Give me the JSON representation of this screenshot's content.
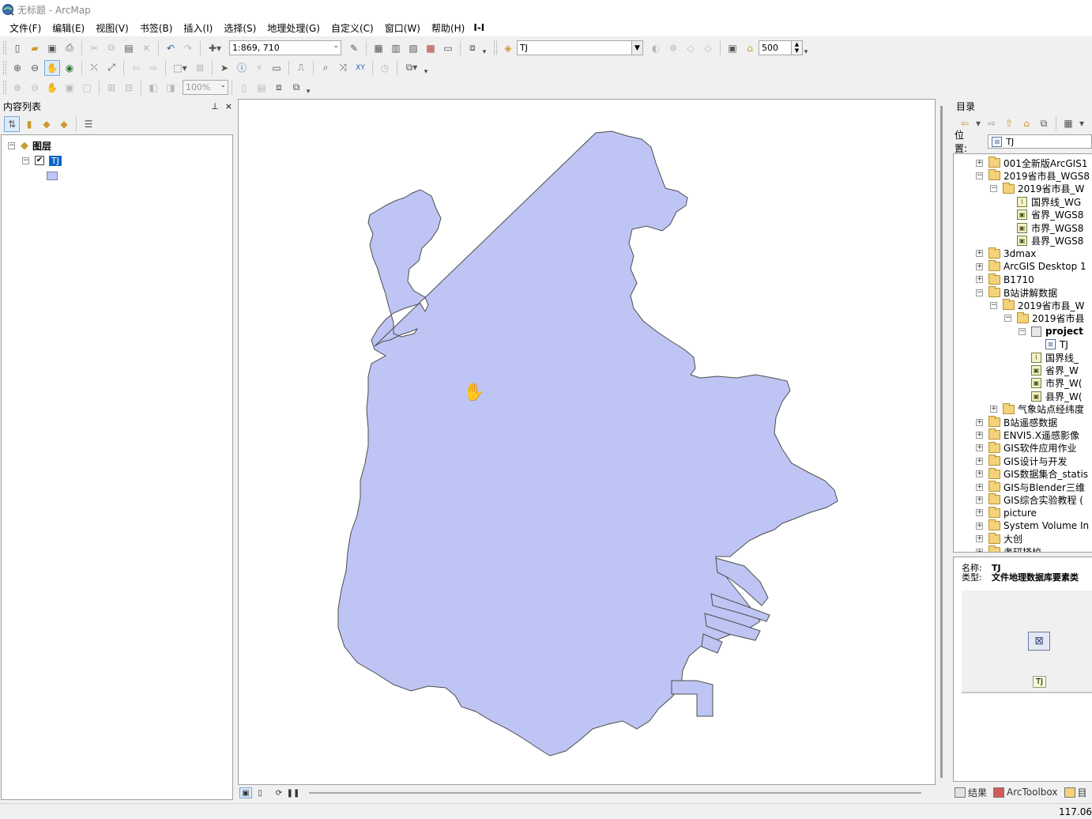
{
  "window": {
    "title": "无标题 - ArcMap"
  },
  "menu": {
    "items": [
      "文件(F)",
      "编辑(E)",
      "视图(V)",
      "书签(B)",
      "插入(I)",
      "选择(S)",
      "地理处理(G)",
      "自定义(C)",
      "窗口(W)",
      "帮助(H)"
    ],
    "grip": "I-I"
  },
  "standard_toolbar": {
    "scale_value": "1:869, 710",
    "target_layer": "TJ",
    "snap_tolerance": "500"
  },
  "layout_toolbar": {
    "zoom_percent": "100%"
  },
  "toc": {
    "title": "内容列表",
    "pin_label": "⊥",
    "close_label": "×",
    "root_label": "图层",
    "layer_name": "TJ",
    "layer_checked": "✔",
    "patch_color": "#bec5f4"
  },
  "map": {
    "fill_color": "#bec5f4",
    "outline_color": "#4d4d4d",
    "cursor": "✋"
  },
  "catalog": {
    "title": "目录",
    "location_label": "位置:",
    "location_value": "TJ",
    "tree": [
      {
        "label": "001全新版ArcGIS1",
        "expander": "+",
        "icon": "folder"
      },
      {
        "label": "2019省市县_WGS8",
        "expander": "-",
        "icon": "folder"
      },
      {
        "label": "2019省市县_W",
        "expander": "-",
        "icon": "folder"
      },
      {
        "label": "国界线_WG",
        "expander": "",
        "icon": "line"
      },
      {
        "label": "省界_WGS8",
        "expander": "",
        "icon": "poly"
      },
      {
        "label": "市界_WGS8",
        "expander": "",
        "icon": "poly"
      },
      {
        "label": "县界_WGS8",
        "expander": "",
        "icon": "poly"
      },
      {
        "label": "3dmax",
        "expander": "+",
        "icon": "folder"
      },
      {
        "label": "ArcGIS Desktop 1",
        "expander": "+",
        "icon": "folder"
      },
      {
        "label": "B1710",
        "expander": "+",
        "icon": "folder"
      },
      {
        "label": "B站讲解数据",
        "expander": "-",
        "icon": "folder"
      },
      {
        "label": "2019省市县_W",
        "expander": "-",
        "icon": "folder"
      },
      {
        "label": "2019省市县",
        "expander": "-",
        "icon": "folder"
      },
      {
        "label": "project",
        "expander": "-",
        "icon": "gdb"
      },
      {
        "label": "TJ",
        "expander": "",
        "icon": "tjfc"
      },
      {
        "label": "国界线_",
        "expander": "",
        "icon": "line"
      },
      {
        "label": "省界_W",
        "expander": "",
        "icon": "poly"
      },
      {
        "label": "市界_W(",
        "expander": "",
        "icon": "poly"
      },
      {
        "label": "县界_W(",
        "expander": "",
        "icon": "poly"
      },
      {
        "label": "气象站点经纬度",
        "expander": "+",
        "icon": "folder"
      },
      {
        "label": "B站遥感数据",
        "expander": "+",
        "icon": "folder"
      },
      {
        "label": "ENVI5.X遥感影像",
        "expander": "+",
        "icon": "folder"
      },
      {
        "label": "GIS软件应用作业",
        "expander": "+",
        "icon": "folder"
      },
      {
        "label": "GIS设计与开发",
        "expander": "+",
        "icon": "folder"
      },
      {
        "label": "GIS数据集合_statis",
        "expander": "+",
        "icon": "folder"
      },
      {
        "label": "GIS与Blender三维",
        "expander": "+",
        "icon": "folder"
      },
      {
        "label": "GIS综合实验教程 (",
        "expander": "+",
        "icon": "folder"
      },
      {
        "label": "picture",
        "expander": "+",
        "icon": "folder"
      },
      {
        "label": "System Volume In",
        "expander": "+",
        "icon": "folder"
      },
      {
        "label": "大创",
        "expander": "+",
        "icon": "folder"
      },
      {
        "label": "考研择校",
        "expander": "+",
        "icon": "folder"
      }
    ],
    "info": {
      "name_key": "名称:",
      "name_value": "TJ",
      "type_key": "类型:",
      "type_value": "文件地理数据库要素类",
      "preview_label": "TJ"
    },
    "tabs": {
      "results": "结果",
      "arctoolbox": "ArcToolbox",
      "catalog": "目"
    }
  },
  "status": {
    "coordinates": "117.06"
  }
}
